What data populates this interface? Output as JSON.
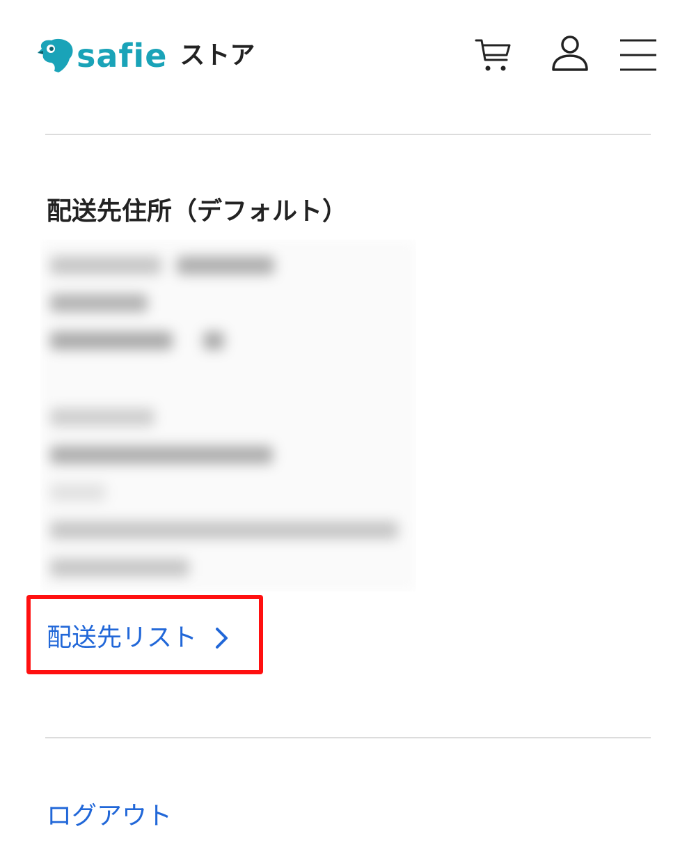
{
  "header": {
    "logo_text": "safie",
    "logo_suffix": "ストア",
    "brand_color": "#1aa3b8",
    "icons": [
      "cart-icon",
      "user-icon",
      "hamburger-menu-icon"
    ]
  },
  "address_section": {
    "title": "配送先住所（デフォルト）",
    "address_list_link": "配送先リスト"
  },
  "logout_label": "ログアウト",
  "colors": {
    "link": "#2167d8",
    "highlight": "#ff1010"
  }
}
